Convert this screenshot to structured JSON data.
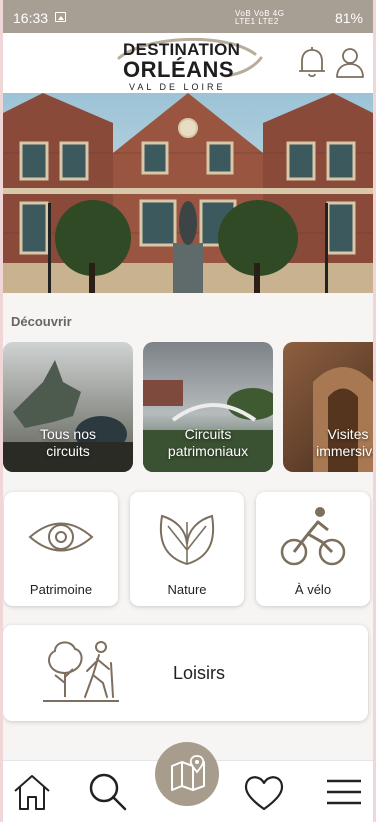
{
  "status_bar": {
    "time": "16:33",
    "network_line1": "VoB  VoB 4G",
    "network_line2": "LTE1  LTE2",
    "battery": "81%"
  },
  "header": {
    "logo_line1": "DESTINATION",
    "logo_line2": "ORLÉANS",
    "logo_line3": "VAL DE LOIRE"
  },
  "discover": {
    "title": "Découvrir",
    "cards": [
      {
        "caption": "Tous nos\ncircuits"
      },
      {
        "caption": "Circuits\npatrimoniaux"
      },
      {
        "caption": "Visites\nimmersive"
      }
    ]
  },
  "categories": [
    {
      "label": "Patrimoine",
      "icon": "eye-icon"
    },
    {
      "label": "Nature",
      "icon": "leaves-icon"
    },
    {
      "label": "À vélo",
      "icon": "cyclist-icon"
    }
  ],
  "leisure": {
    "label": "Loisirs",
    "icon": "hiker-icon"
  },
  "nav": [
    "home-icon",
    "search-icon",
    "map-icon",
    "heart-icon",
    "menu-icon"
  ],
  "colors": {
    "accent": "#a89c8c",
    "status_bar": "#a89f94",
    "icon_stroke": "#7d6f5e"
  }
}
